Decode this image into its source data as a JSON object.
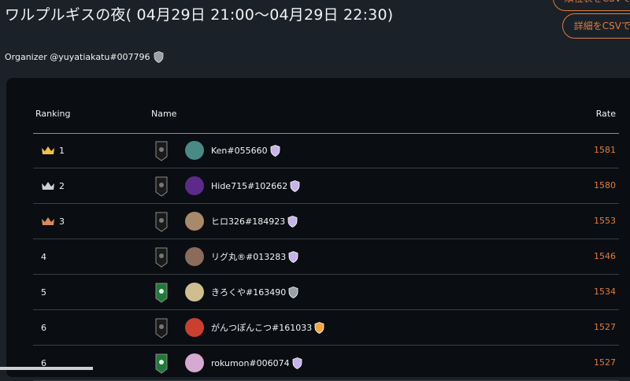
{
  "title": "ワルプルギスの夜( 04月29日 21:00〜04月29日 22:30)",
  "buttons": {
    "top_partial": "順位表をCSVで出力",
    "detail_csv": "詳細をCSVで出力"
  },
  "organizer": {
    "label": "Organizer @yuyatiakatu#007796"
  },
  "table": {
    "headers": {
      "ranking": "Ranking",
      "name": "Name",
      "rate": "Rate"
    },
    "rows": [
      {
        "rank": "1",
        "crown": "gold",
        "banner": "dark",
        "avatar": "#4a8a86",
        "player": "Ken#055660",
        "shield": "purple",
        "rate": "1581"
      },
      {
        "rank": "2",
        "crown": "silver",
        "banner": "dark",
        "avatar": "#5d2a8a",
        "player": "Hide715#102662",
        "shield": "purple",
        "rate": "1580"
      },
      {
        "rank": "3",
        "crown": "bronze",
        "banner": "dark",
        "avatar": "#a8896a",
        "player": "ヒロ326#184923",
        "shield": "purple",
        "rate": "1553"
      },
      {
        "rank": "4",
        "crown": "",
        "banner": "dark",
        "avatar": "#8c6b5a",
        "player": "リグ丸®#013283",
        "shield": "purple",
        "rate": "1546"
      },
      {
        "rank": "5",
        "crown": "",
        "banner": "green",
        "avatar": "#cdbf8f",
        "player": "きろくや#163490",
        "shield": "gray",
        "rate": "1534"
      },
      {
        "rank": "6",
        "crown": "",
        "banner": "dark",
        "avatar": "#c9402e",
        "player": "がんつぽんこつ#161033",
        "shield": "orange",
        "rate": "1527"
      },
      {
        "rank": "6",
        "crown": "",
        "banner": "green",
        "avatar": "#d6a9d0",
        "player": "rokumon#006074",
        "shield": "purple",
        "rate": "1527"
      }
    ]
  },
  "colors": {
    "accent": "#e07b39",
    "crown_gold": "#f0c040",
    "crown_silver": "#cfcfcf",
    "crown_bronze": "#d98a5a",
    "shield_purple": "#c6b3e8",
    "shield_gray": "#9aa0a6",
    "shield_orange": "#f2a540",
    "banner_dark": "#1a1a1a",
    "banner_green": "#1e7a3a"
  }
}
